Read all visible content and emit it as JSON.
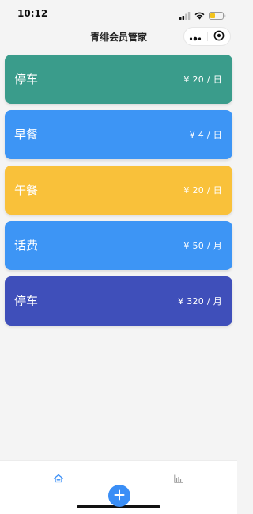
{
  "status_bar": {
    "time": "10:12"
  },
  "nav": {
    "title": "青绯会员管家"
  },
  "cards": [
    {
      "name": "停车",
      "price": "¥ 20 / 日",
      "color": "#3a9c8b"
    },
    {
      "name": "早餐",
      "price": "¥ 4 / 日",
      "color": "#3d95f5"
    },
    {
      "name": "午餐",
      "price": "¥ 20 / 日",
      "color": "#f9c13a"
    },
    {
      "name": "话费",
      "price": "¥ 50 / 月",
      "color": "#3d95f5"
    },
    {
      "name": "停车",
      "price": "¥ 320 / 月",
      "color": "#3f4fba"
    }
  ],
  "tab_bar": {
    "active_color": "#3a8ef6",
    "inactive_color": "#9a9a9a",
    "items": [
      {
        "icon": "home-icon",
        "active": true
      },
      {
        "icon": "bar-chart-icon",
        "active": false
      }
    ],
    "fab_icon": "plus-icon"
  }
}
